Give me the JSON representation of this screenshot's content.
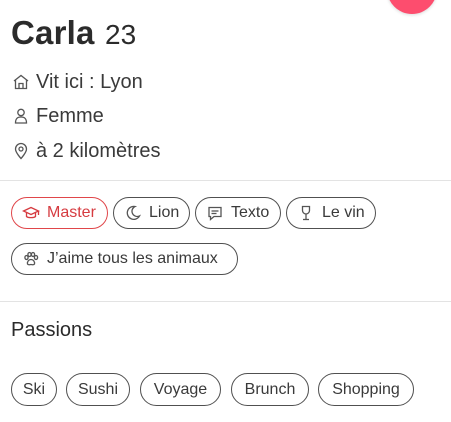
{
  "profile": {
    "name": "Carla",
    "age": "23",
    "info": [
      {
        "icon": "house-icon",
        "text": "Vit ici : Lyon"
      },
      {
        "icon": "person-icon",
        "text": "Femme"
      },
      {
        "icon": "location-pin-icon",
        "text": "à 2 kilomètres"
      }
    ]
  },
  "basics": {
    "chips": [
      {
        "icon": "graduation-cap-icon",
        "label": "Master",
        "active": true
      },
      {
        "icon": "moon-icon",
        "label": "Lion",
        "active": false
      },
      {
        "icon": "chat-bubble-icon",
        "label": "Texto",
        "active": false
      },
      {
        "icon": "wine-glass-icon",
        "label": "Le vin",
        "active": false
      },
      {
        "icon": "paw-icon",
        "label": "J’aime tous les animaux",
        "active": false
      }
    ]
  },
  "passions": {
    "title": "Passions",
    "chips": [
      "Ski",
      "Sushi",
      "Voyage",
      "Brunch",
      "Shopping"
    ]
  },
  "colors": {
    "accent": "#fd4d6e",
    "active_chip": "#e0464a",
    "text": "#2b2b2b",
    "divider": "#e3e3e3"
  }
}
